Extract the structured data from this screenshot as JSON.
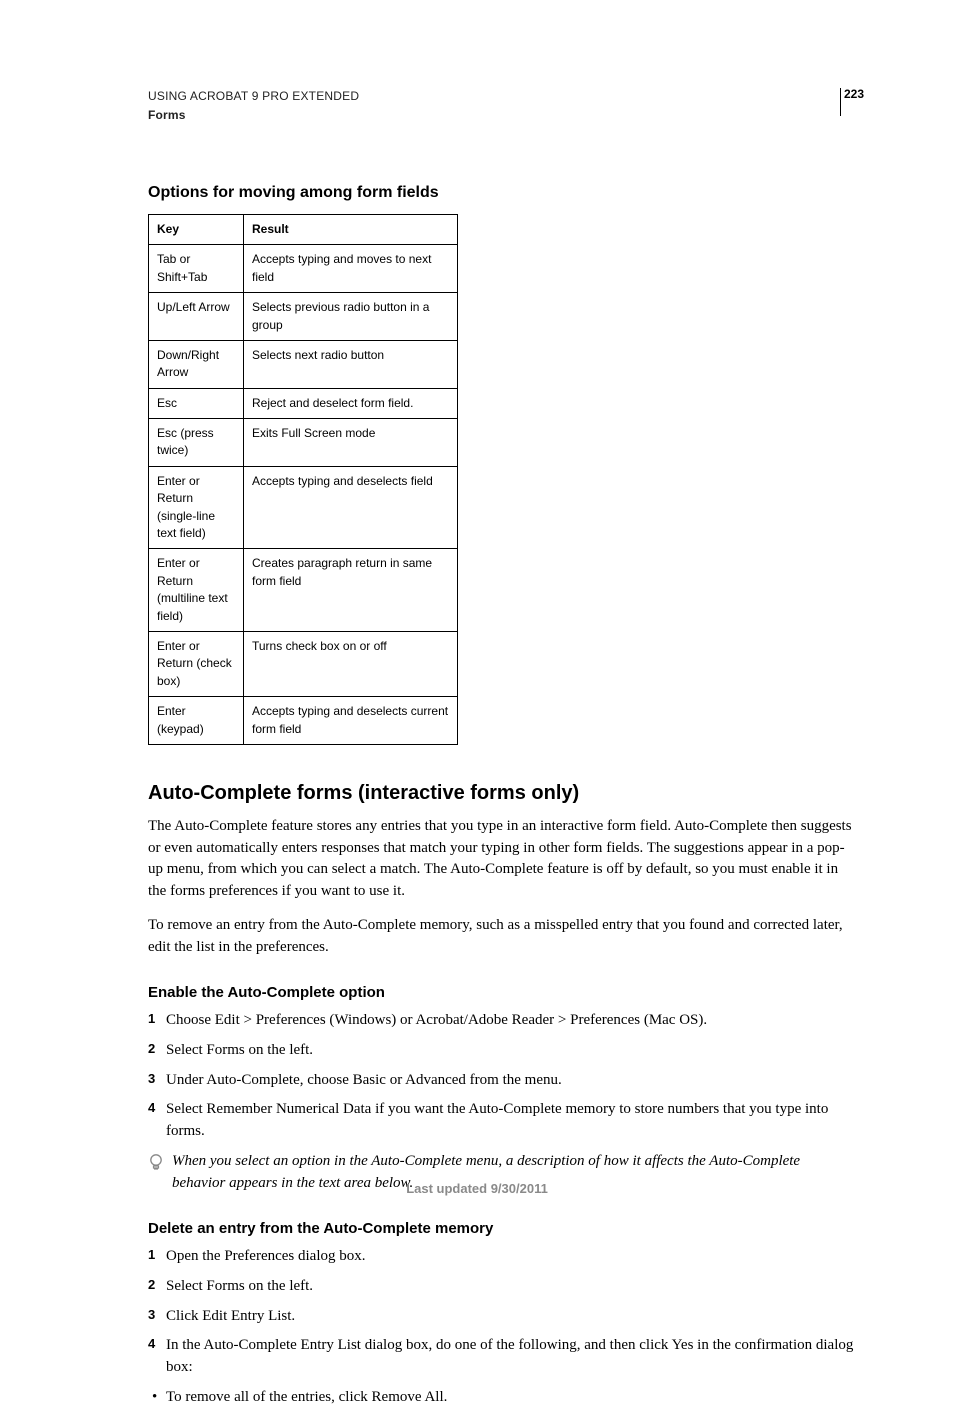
{
  "header": {
    "line1": "USING ACROBAT 9 PRO EXTENDED",
    "line2": "Forms",
    "page_number": "223"
  },
  "section1": {
    "title": "Options for moving among form fields",
    "table": {
      "headers": {
        "key": "Key",
        "result": "Result"
      },
      "rows": [
        {
          "key": "Tab or Shift+Tab",
          "result": "Accepts typing and moves to next field"
        },
        {
          "key": "Up/Left Arrow",
          "result": "Selects previous radio button in a group"
        },
        {
          "key": "Down/Right Arrow",
          "result": "Selects next radio button"
        },
        {
          "key": "Esc",
          "result": "Reject and deselect form field."
        },
        {
          "key": "Esc (press twice)",
          "result": "Exits Full Screen mode"
        },
        {
          "key": "Enter or Return (single-line text field)",
          "result": "Accepts typing and deselects field"
        },
        {
          "key": "Enter or Return (multiline text field)",
          "result": "Creates paragraph return in same form field"
        },
        {
          "key": "Enter or Return (check box)",
          "result": "Turns check box on or off"
        },
        {
          "key": "Enter (keypad)",
          "result": "Accepts typing and deselects current form field"
        }
      ]
    }
  },
  "section2": {
    "title": "Auto-Complete forms (interactive forms only)",
    "p1": "The Auto-Complete feature stores any entries that you type in an interactive form field. Auto-Complete then suggests or even automatically enters responses that match your typing in other form fields. The suggestions appear in a pop-up menu, from which you can select a match. The Auto-Complete feature is off by default, so you must enable it in the forms preferences if you want to use it.",
    "p2": "To remove an entry from the Auto-Complete memory, such as a misspelled entry that you found and corrected later, edit the list in the preferences."
  },
  "enable": {
    "title": "Enable the Auto-Complete option",
    "steps": [
      "Choose Edit > Preferences (Windows) or Acrobat/Adobe Reader > Preferences (Mac OS).",
      "Select Forms on the left.",
      "Under Auto-Complete, choose Basic or Advanced from the menu.",
      "Select Remember Numerical Data if you want the Auto-Complete memory to store numbers that you type into forms."
    ],
    "tip": "When you select an option in the Auto-Complete menu, a description of how it affects the Auto-Complete behavior appears in the text area below."
  },
  "delete": {
    "title": "Delete an entry from the Auto-Complete memory",
    "steps": [
      "Open the Preferences dialog box.",
      "Select Forms on the left.",
      "Click Edit Entry List.",
      "In the Auto-Complete Entry List dialog box, do one of the following, and then click Yes in the confirmation dialog box:"
    ],
    "bullets": [
      "To remove all of the entries, click Remove All."
    ]
  },
  "footer": {
    "updated": "Last updated 9/30/2011"
  }
}
